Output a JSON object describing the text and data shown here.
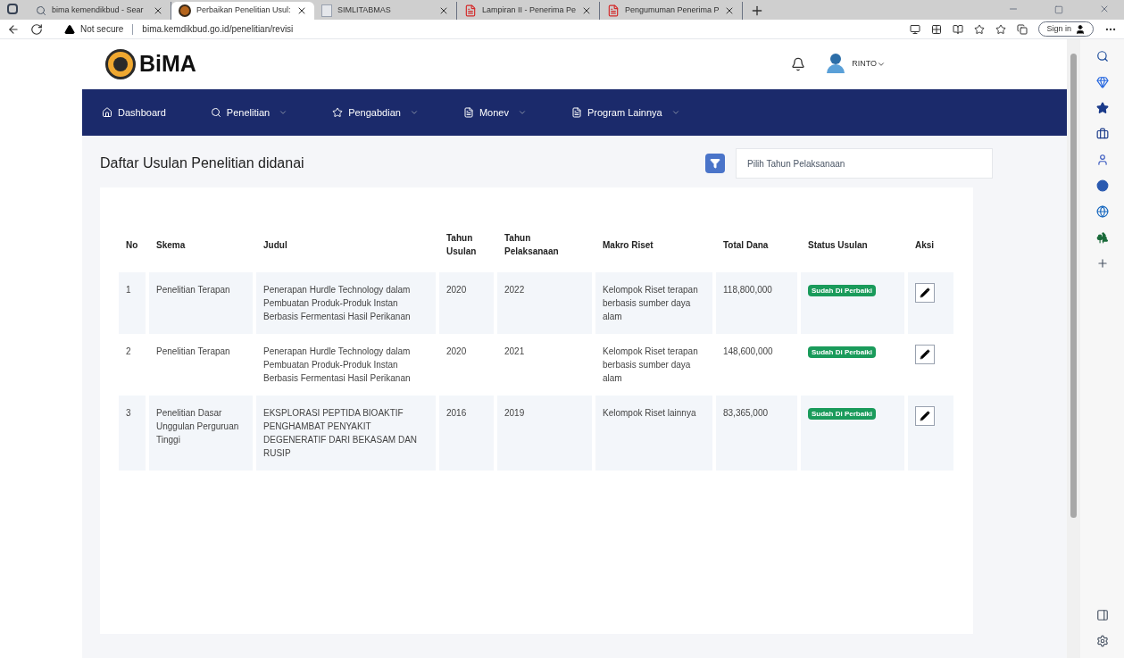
{
  "browser": {
    "tabs": [
      {
        "label": "bima kemendikbud - Sear",
        "kind": "search",
        "selected": false
      },
      {
        "label": "Perbaikan Penelitian Usul:",
        "kind": "site",
        "selected": true
      },
      {
        "label": "SIMLITABMAS",
        "kind": "page",
        "selected": false
      },
      {
        "label": "Lampiran II - Penerima Pe",
        "kind": "pdf",
        "selected": false
      },
      {
        "label": "Pengumuman Penerima P",
        "kind": "pdf",
        "selected": false
      }
    ],
    "security": "Not secure",
    "url": "bima.kemdikbud.go.id/penelitian/revisi",
    "sign_in": "Sign in"
  },
  "header": {
    "logo": "BiMA",
    "user": "RINTO"
  },
  "nav": [
    {
      "label": "Dashboard",
      "kind": "home",
      "dropdown": false
    },
    {
      "label": "Penelitian",
      "kind": "search",
      "dropdown": true
    },
    {
      "label": "Pengabdian",
      "kind": "star",
      "dropdown": true
    },
    {
      "label": "Monev",
      "kind": "doc",
      "dropdown": true
    },
    {
      "label": "Program Lainnya",
      "kind": "doc",
      "dropdown": true
    }
  ],
  "page_title": "Daftar Usulan Penelitian didanai",
  "year_filter": {
    "placeholder": "Pilih Tahun Pelaksanaan"
  },
  "table": {
    "columns": [
      "No",
      "Skema",
      "Judul",
      "Tahun Usulan",
      "Tahun Pelaksanaan",
      "Makro Riset",
      "Total Dana",
      "Status Usulan",
      "Aksi"
    ],
    "rows": [
      {
        "no": "1",
        "skema": "Penelitian Terapan",
        "judul": "Penerapan Hurdle Technology dalam Pembuatan Produk-Produk Instan Berbasis Fermentasi Hasil Perikanan",
        "tahun_usulan": "2020",
        "tahun_pelaksanaan": "2022",
        "makro_riset": "Kelompok Riset terapan berbasis sumber daya alam",
        "total_dana": "118,800,000",
        "status": "Sudah Di Perbaiki"
      },
      {
        "no": "2",
        "skema": "Penelitian Terapan",
        "judul": "Penerapan Hurdle Technology dalam Pembuatan Produk-Produk Instan Berbasis Fermentasi Hasil Perikanan",
        "tahun_usulan": "2020",
        "tahun_pelaksanaan": "2021",
        "makro_riset": "Kelompok Riset terapan berbasis sumber daya alam",
        "total_dana": "148,600,000",
        "status": "Sudah Di Perbaiki"
      },
      {
        "no": "3",
        "skema": "Penelitian Dasar Unggulan Perguruan Tinggi",
        "judul": "EKSPLORASI PEPTIDA BIOAKTIF PENGHAMBAT PENYAKIT DEGENERATIF DARI BEKASAM DAN RUSIP",
        "tahun_usulan": "2016",
        "tahun_pelaksanaan": "2019",
        "makro_riset": "Kelompok Riset lainnya",
        "total_dana": "83,365,000",
        "status": "Sudah Di Perbaiki"
      }
    ]
  }
}
